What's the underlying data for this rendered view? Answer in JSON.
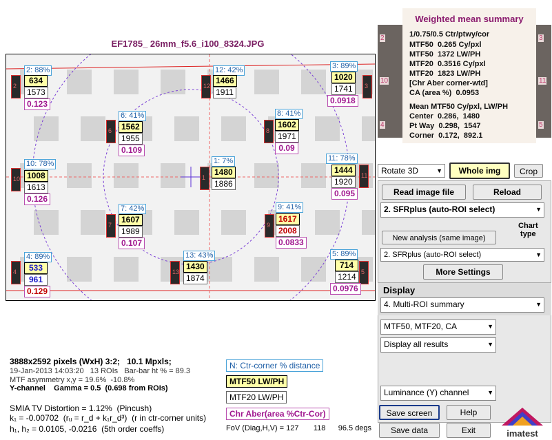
{
  "title": "EF1785_ 26mm_f5.6_i100_8324.JPG",
  "rois": [
    {
      "pos": "2: 88%",
      "m50": "634",
      "m20": "1573",
      "ca": "0.123"
    },
    {
      "pos": "12: 42%",
      "m50": "1466",
      "m20": "1911",
      "ca": ""
    },
    {
      "pos": "3: 89%",
      "m50": "1020",
      "m20": "1741",
      "ca": "0.0918"
    },
    {
      "pos": "6: 41%",
      "m50": "1562",
      "m20": "1955",
      "ca": "0.109"
    },
    {
      "pos": "8: 41%",
      "m50": "1602",
      "m20": "1971",
      "ca": "0.09"
    },
    {
      "pos": "10: 78%",
      "m50": "1008",
      "m20": "1613",
      "ca": "0.126"
    },
    {
      "pos": "1: 7%",
      "m50": "1480",
      "m20": "1886",
      "ca": ""
    },
    {
      "pos": "11: 78%",
      "m50": "1444",
      "m20": "1920",
      "ca": "0.095"
    },
    {
      "pos": "7: 42%",
      "m50": "1607",
      "m20": "1989",
      "ca": "0.107"
    },
    {
      "pos": "9: 41%",
      "m50": "1617",
      "m20": "2008",
      "ca": "0.0833"
    },
    {
      "pos": "4: 89%",
      "m50": "533",
      "m20": "961",
      "ca": "0.129"
    },
    {
      "pos": "13: 43%",
      "m50": "1430",
      "m20": "1874",
      "ca": ""
    },
    {
      "pos": "5: 89%",
      "m50": "714",
      "m20": "1214",
      "ca": "0.0976"
    }
  ],
  "roi_ids": [
    "2",
    "12",
    "3",
    "6",
    "8",
    "10",
    "1",
    "11",
    "7",
    "9",
    "4",
    "13",
    "5"
  ],
  "summary": {
    "title": "Weighted mean summary",
    "lines": [
      "1/0.75/0.5 Ctr/ptwy/cor",
      "MTF50  0.265 Cy/pxl",
      "MTF50  1372 LW/PH",
      "MTF20  0.3516 Cy/pxl",
      "MTF20  1823 LW/PH",
      "[Chr Aber corner-wtd]",
      "CA (area %)  0.0953",
      "Mean MTF50 Cy/pxl, LW/PH",
      "Center  0.286,  1480",
      "Pt Way  0.298,  1547",
      "Corner  0.172,  892.1"
    ],
    "thumb_labels": [
      "2",
      "10",
      "4",
      "3",
      "11",
      "5"
    ]
  },
  "controls": {
    "rotate": "Rotate 3D",
    "whole_img": "Whole img",
    "crop": "Crop",
    "read_file": "Read image file",
    "reload": "Reload",
    "mode_select": "2. SFRplus (auto-ROI select)",
    "chart_type_label": "Chart\ntype",
    "new_analysis": "New analysis (same image)",
    "chart_type_select": "2. SFRplus (auto-ROI select)",
    "more_settings": "More Settings",
    "display_label": "Display",
    "display_select": "4.   Multi-ROI summary",
    "metric_select": "MTF50, MTF20, CA",
    "results_select": "Display all results",
    "channel_select": "Luminance (Y) channel",
    "save_screen": "Save screen",
    "help": "Help",
    "save_data": "Save data",
    "exit": "Exit",
    "logo": "imatest"
  },
  "info": {
    "line1": "3888x2592 pixels (WxH) 3:2;   10.1 Mpxls;",
    "line2": "19-Jan-2013 14:03:20   13 ROIs   Bar-bar ht % = 89.3",
    "line3": "MTF asymmetry x,y = 19.6%  -10.8%",
    "line4": "Y-channel    Gamma = 0.5  (0.698 from ROIs)",
    "line5": "SMIA TV Distortion = 1.12%  (Pincush)",
    "line6": "k₁ = -0.00702  (rᵤ = r_d + k₁r_d³)  (r in ctr-corner units)",
    "line7": "h₁, h₂ = 0.0105, -0.0216  (5th order coeffs)",
    "fov": "FoV (Diag,H,V) = 127       118      96.5 degs"
  },
  "legend": {
    "pos": "N:  Ctr-corner % distance",
    "m50": "MTF50  LW/PH",
    "m20": "MTF20  LW/PH",
    "ca": "Chr Aber(area %Ctr-Cor)"
  }
}
